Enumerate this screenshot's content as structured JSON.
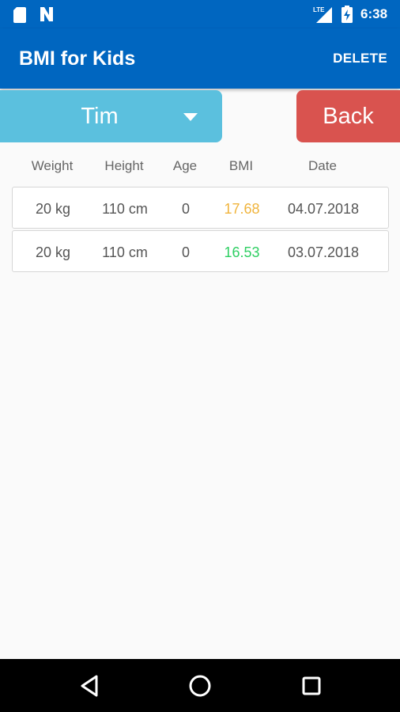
{
  "status_bar": {
    "time": "6:38",
    "network": "LTE",
    "icons": [
      "sd-card-icon",
      "n-icon",
      "lte-signal-icon",
      "battery-charging-icon"
    ]
  },
  "app_bar": {
    "title": "BMI for Kids",
    "action_label": "DELETE"
  },
  "child_selector": {
    "selected": "Tim",
    "icon": "dropdown-caret-icon"
  },
  "back_button": {
    "label": "Back"
  },
  "table": {
    "columns": [
      "Weight",
      "Height",
      "Age",
      "BMI",
      "Date"
    ],
    "rows": [
      {
        "weight": "20 kg",
        "height": "110 cm",
        "age": "0",
        "bmi": "17.68",
        "bmi_color": "#f0b43c",
        "date": "04.07.2018"
      },
      {
        "weight": "20 kg",
        "height": "110 cm",
        "age": "0",
        "bmi": "16.53",
        "bmi_color": "#2fcf63",
        "date": "03.07.2018"
      }
    ]
  },
  "colors": {
    "primary": "#0066c0",
    "selector": "#5bc0de",
    "back": "#d9534f"
  },
  "nav_bar": {
    "icons": [
      "back-triangle-icon",
      "home-circle-icon",
      "recents-square-icon"
    ]
  }
}
